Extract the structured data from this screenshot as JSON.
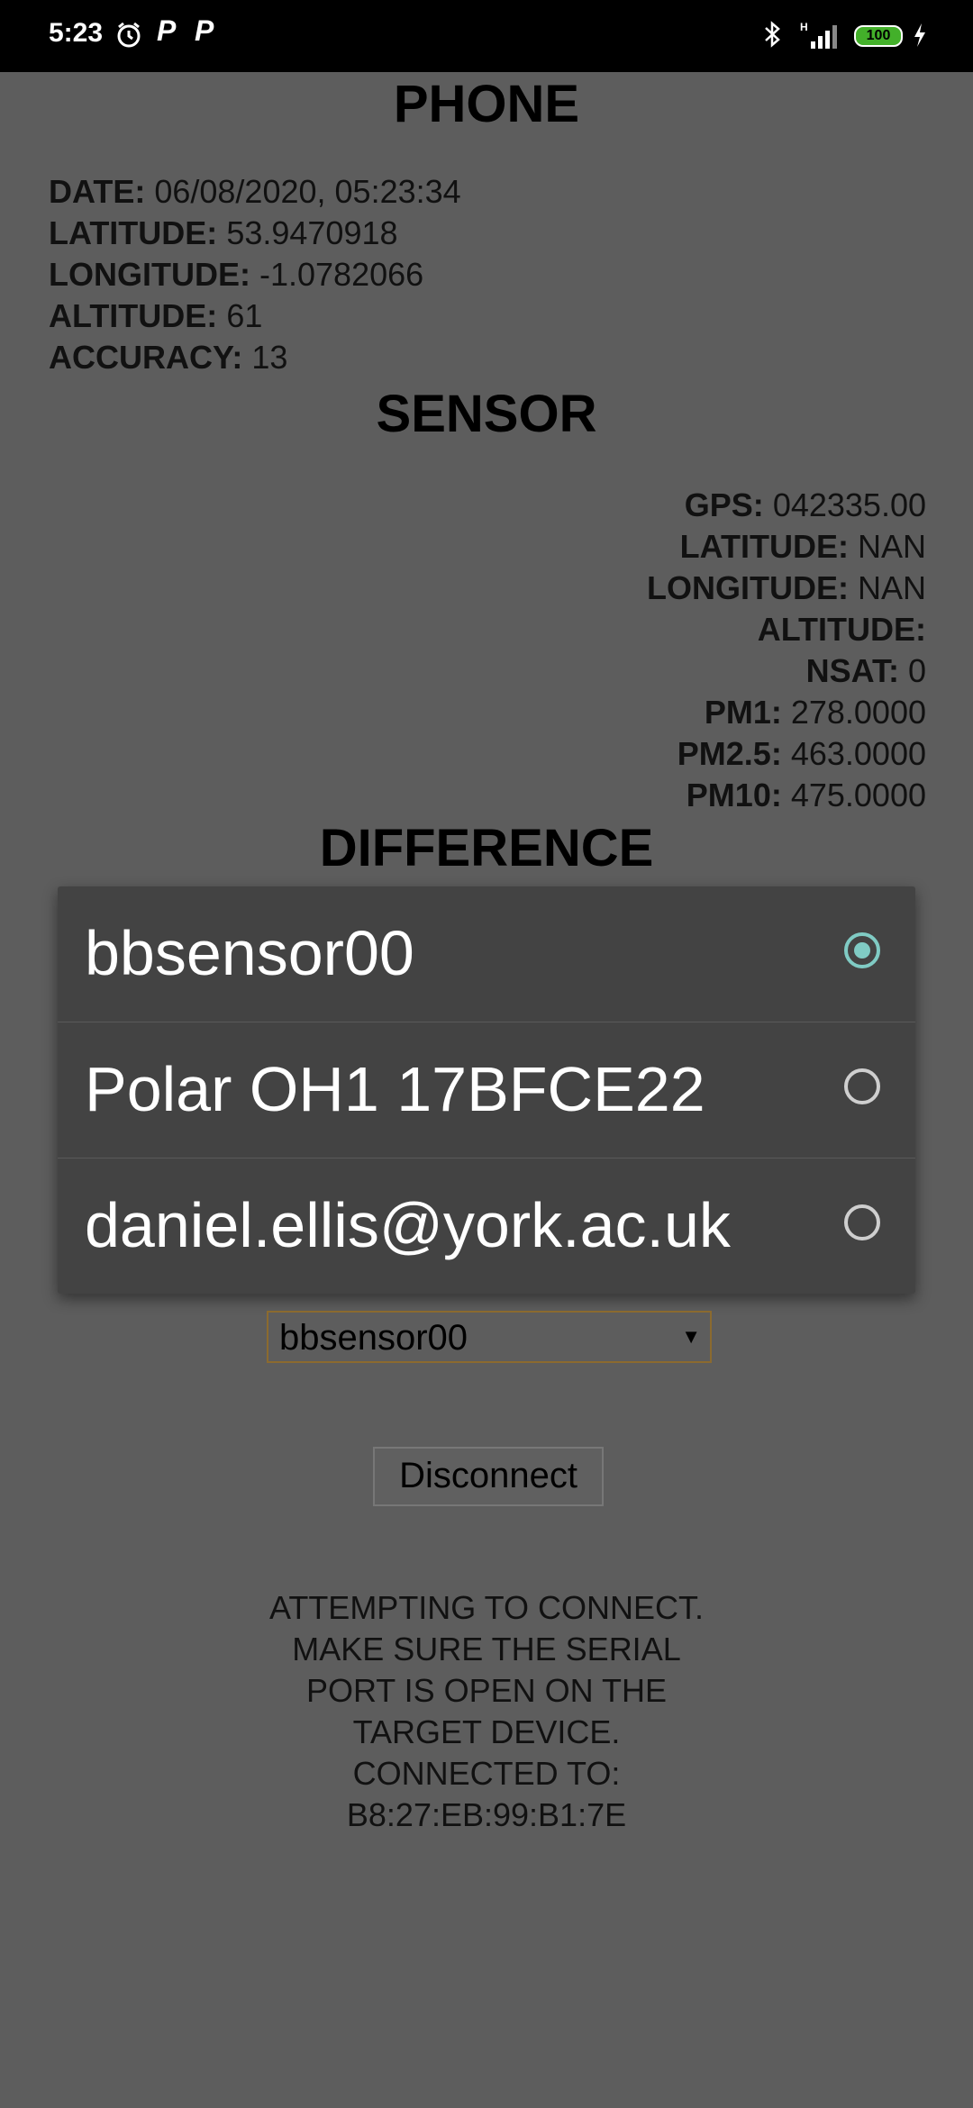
{
  "statusbar": {
    "time": "5:23",
    "network": "H",
    "battery": "100",
    "notif_p1": "P",
    "notif_p2": "P"
  },
  "phone": {
    "heading": "PHONE",
    "date_label": "DATE:",
    "date_value": "06/08/2020, 05:23:34",
    "latitude_label": "LATITUDE:",
    "latitude_value": "53.9470918",
    "longitude_label": "LONGITUDE:",
    "longitude_value": "-1.0782066",
    "altitude_label": "ALTITUDE:",
    "altitude_value": "61",
    "accuracy_label": "ACCURACY:",
    "accuracy_value": "13"
  },
  "sensor": {
    "heading": "SENSOR",
    "gps_label": "GPS:",
    "gps_value": "042335.00",
    "latitude_label": "LATITUDE:",
    "latitude_value": "NAN",
    "longitude_label": "LONGITUDE:",
    "longitude_value": "NAN",
    "altitude_label": "ALTITUDE:",
    "altitude_value": "",
    "nsat_label": "NSAT:",
    "nsat_value": "0",
    "pm1_label": "PM1:",
    "pm1_value": "278.0000",
    "pm25_label": "PM2.5:",
    "pm25_value": "463.0000",
    "pm10_label": "PM10:",
    "pm10_value": "475.0000"
  },
  "difference": {
    "heading": "DIFFERENCE"
  },
  "device_picker": {
    "options": [
      {
        "label": "bbsensor00",
        "selected": true
      },
      {
        "label": "Polar OH1 17BFCE22",
        "selected": false
      },
      {
        "label": "daniel.ellis@york.ac.uk",
        "selected": false
      }
    ]
  },
  "select": {
    "value": "bbsensor00",
    "arrow": "▼"
  },
  "disconnect_label": "Disconnect",
  "status": {
    "line1": "ATTEMPTING TO CONNECT.",
    "line2": "MAKE SURE THE SERIAL",
    "line3": "PORT IS OPEN ON THE",
    "line4": "TARGET DEVICE.",
    "line5": "CONNECTED TO:",
    "line6": "B8:27:EB:99:B1:7E"
  },
  "colors": {
    "background": "#5d5d5d",
    "dialog": "#434343",
    "radio_accent": "#80cbc4",
    "battery": "#43b02a"
  }
}
